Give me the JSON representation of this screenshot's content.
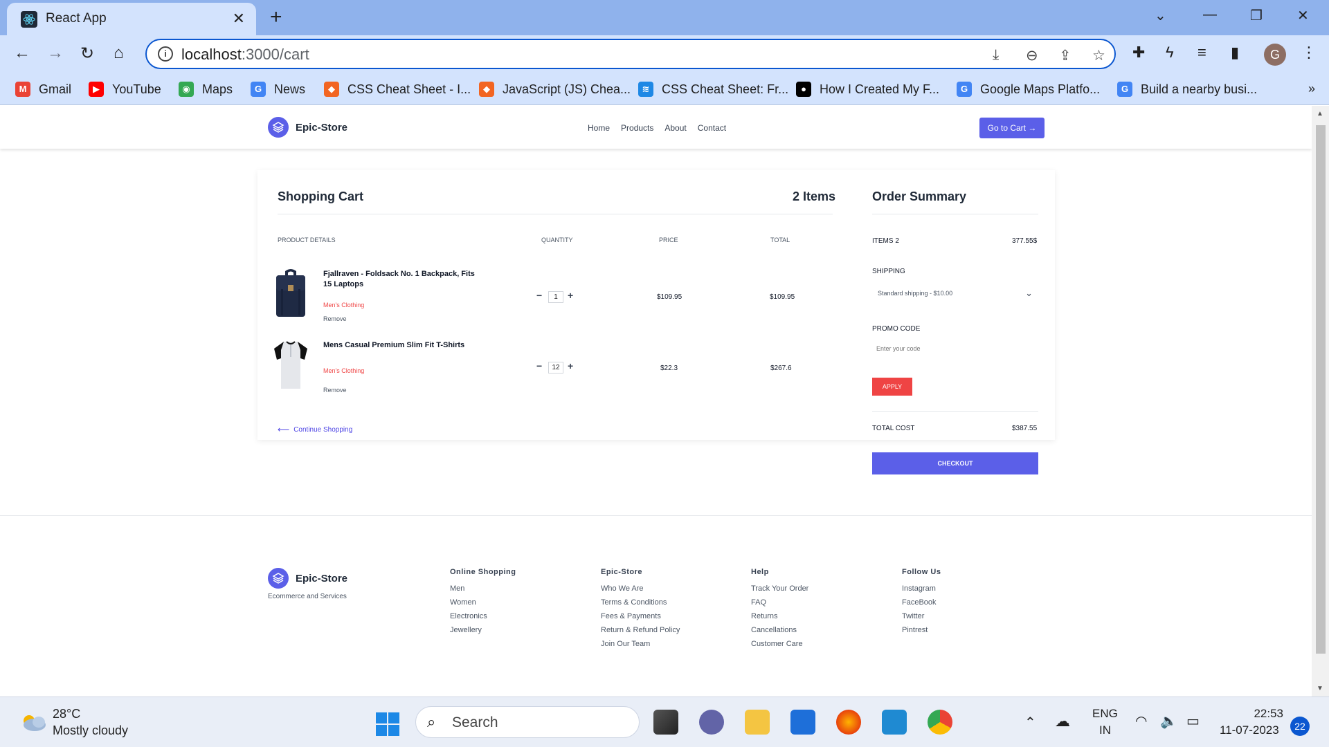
{
  "browser": {
    "tab_title": "React App",
    "url_host": "localhost",
    "url_path": ":3000/cart",
    "bookmarks": [
      {
        "label": "Gmail",
        "color": "#ea4335",
        "glyph": "M"
      },
      {
        "label": "YouTube",
        "color": "#ff0000",
        "glyph": "▶"
      },
      {
        "label": "Maps",
        "color": "#34a853",
        "glyph": "◉"
      },
      {
        "label": "News",
        "color": "#4285f4",
        "glyph": "G"
      },
      {
        "label": "CSS Cheat Sheet - I...",
        "color": "#f26522",
        "glyph": "◆"
      },
      {
        "label": "JavaScript (JS) Chea...",
        "color": "#f26522",
        "glyph": "◆"
      },
      {
        "label": "CSS Cheat Sheet: Fr...",
        "color": "#1e88e5",
        "glyph": "≋"
      },
      {
        "label": "How I Created My F...",
        "color": "#000000",
        "glyph": "●"
      },
      {
        "label": "Google Maps Platfo...",
        "color": "#4285f4",
        "glyph": "G"
      },
      {
        "label": "Build a nearby busi...",
        "color": "#4285f4",
        "glyph": "G"
      }
    ],
    "bookmarks_more": "»",
    "profile_initial": "G"
  },
  "site": {
    "brand": "Epic-Store",
    "nav": [
      "Home",
      "Products",
      "About",
      "Contact"
    ],
    "cta": "Go to Cart →"
  },
  "cart": {
    "title": "Shopping Cart",
    "count_label": "2 Items",
    "columns": [
      "Product Details",
      "Quantity",
      "Price",
      "Total"
    ],
    "items": [
      {
        "name": "Fjallraven - Foldsack No. 1 Backpack, Fits 15 Laptops",
        "category": "Men's Clothing",
        "remove": "Remove",
        "qty": "1",
        "price": "$109.95",
        "total": "$109.95"
      },
      {
        "name": "Mens Casual Premium Slim Fit T-Shirts",
        "category": "Men's Clothing",
        "remove": "Remove",
        "qty": "12",
        "price": "$22.3",
        "total": "$267.6"
      }
    ],
    "continue_label": "Continue Shopping"
  },
  "summary": {
    "title": "Order Summary",
    "items_label": "ITEMS 2",
    "items_value": "377.55$",
    "shipping_label": "SHIPPING",
    "shipping_option": "Standard shipping - $10.00",
    "promo_label": "PROMO CODE",
    "promo_placeholder": "Enter your code",
    "apply_label": "APPLY",
    "total_label": "TOTAL COST",
    "total_value": "$387.55",
    "checkout_label": "CHECKOUT"
  },
  "footer": {
    "brand": "Epic-Store",
    "tagline": "Ecommerce and Services",
    "columns": [
      {
        "title": "Online Shopping",
        "links": [
          "Men",
          "Women",
          "Electronics",
          "Jewellery"
        ]
      },
      {
        "title": "Epic-Store",
        "links": [
          "Who We Are",
          "Terms & Conditions",
          "Fees & Payments",
          "Return & Refund Policy",
          "Join Our Team"
        ]
      },
      {
        "title": "Help",
        "links": [
          "Track Your Order",
          "FAQ",
          "Returns",
          "Cancellations",
          "Customer Care"
        ]
      },
      {
        "title": "Follow Us",
        "links": [
          "Instagram",
          "FaceBook",
          "Twitter",
          "Pintrest"
        ]
      }
    ]
  },
  "taskbar": {
    "temperature": "28°C",
    "weather": "Mostly cloudy",
    "search_label": "Search",
    "lang_line1": "ENG",
    "lang_line2": "IN",
    "time": "22:53",
    "date": "11-07-2023",
    "notifications": "22"
  },
  "colors": {
    "accent": "#5b5fe8",
    "danger": "#ef4444",
    "chrome_tab": "#d3e3fd"
  }
}
